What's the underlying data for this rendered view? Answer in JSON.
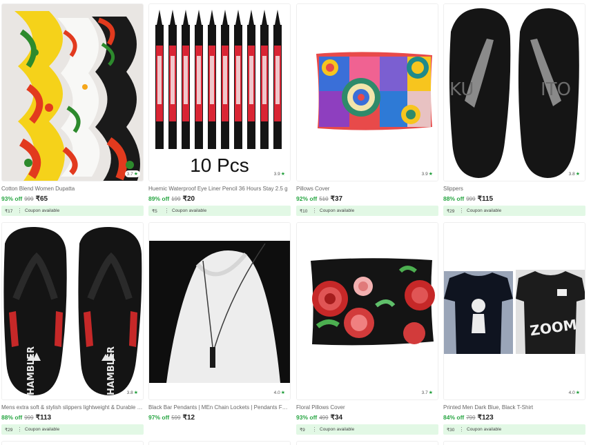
{
  "products": [
    {
      "title": "Cotton Blend Women Dupatta",
      "rating": "3.7",
      "discount": "93% off",
      "mrp": "999",
      "price": "₹65",
      "coupon_amount": "₹17",
      "coupon_text": "Coupon available",
      "image": "dupatta-image"
    },
    {
      "title": "Huemic Waterproof Eye Liner Pencil 36 Hours Stay 2.5 g",
      "rating": "3.9",
      "discount": "89% off",
      "mrp": "199",
      "price": "₹20",
      "coupon_amount": "₹5",
      "coupon_text": "Coupon available",
      "image": "eyeliner-image",
      "image_text": "10 Pcs"
    },
    {
      "title": "Pillows Cover",
      "rating": "3.9",
      "discount": "92% off",
      "mrp": "510",
      "price": "₹37",
      "coupon_amount": "₹10",
      "coupon_text": "Coupon available",
      "image": "pillow-cover-image"
    },
    {
      "title": "Slippers",
      "rating": "3.8",
      "discount": "88% off",
      "mrp": "999",
      "price": "₹115",
      "coupon_amount": "₹29",
      "coupon_text": "Coupon available",
      "image": "slippers-image"
    },
    {
      "title": "Mens extra soft & stylish slippers lightweight & Durable slippers",
      "rating": "3.8",
      "discount": "88% off",
      "mrp": "999",
      "price": "₹113",
      "coupon_amount": "₹29",
      "coupon_text": "Coupon available",
      "image": "hambler-slippers-image"
    },
    {
      "title": "Black Bar Pendants | MEn Chain Lockets | Pendants For Men",
      "rating": "4.0",
      "discount": "97% off",
      "mrp": "599",
      "price": "₹12",
      "coupon_amount": "",
      "coupon_text": "",
      "image": "pendant-image"
    },
    {
      "title": "Floral Pillows Cover",
      "rating": "3.7",
      "discount": "93% off",
      "mrp": "499",
      "price": "₹34",
      "coupon_amount": "₹9",
      "coupon_text": "Coupon available",
      "image": "floral-pillow-image"
    },
    {
      "title": "Printed Men Dark Blue, Black T-Shirt",
      "rating": "4.0",
      "discount": "84% off",
      "mrp": "799",
      "price": "₹123",
      "coupon_amount": "₹30",
      "coupon_text": "Coupon available",
      "image": "tshirt-image"
    }
  ],
  "icons": {
    "rating": "star-icon",
    "coupon_separator": "vertical-dots-icon"
  },
  "colors": {
    "discount": "#26a541",
    "coupon_bg": "#e2f8e5",
    "rating_star": "#1f9d3a"
  }
}
